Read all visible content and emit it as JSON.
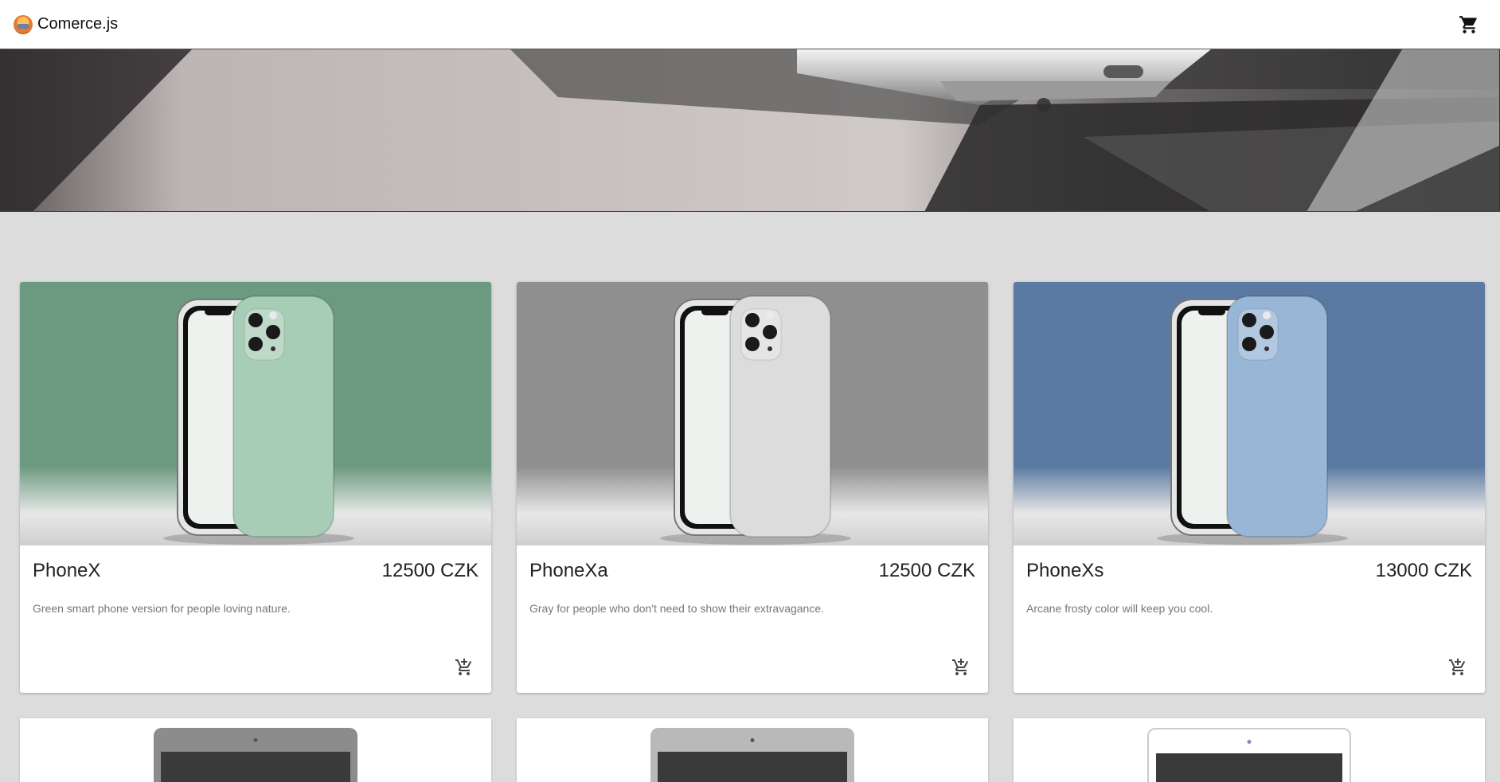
{
  "header": {
    "brand": "Comerce.js",
    "cart_icon": "shopping-cart-icon"
  },
  "products": [
    {
      "name": "PhoneX",
      "price": "12500 CZK",
      "description": "Green smart phone version for people loving nature.",
      "bg_color": "#6c9a80",
      "phone_color": "#a8cdb6"
    },
    {
      "name": "PhoneXa",
      "price": "12500 CZK",
      "description": "Gray for people who don't need to show their extravagance.",
      "bg_color": "#8f8f8f",
      "phone_color": "#dcdcdc"
    },
    {
      "name": "PhoneXs",
      "price": "13000 CZK",
      "description": "Arcane frosty color will keep you cool.",
      "bg_color": "#5b7aa3",
      "phone_color": "#98b6d6"
    }
  ],
  "second_row_tablet_colors": [
    "#8c8c8c",
    "#b9b9b9",
    "#ffffff"
  ]
}
